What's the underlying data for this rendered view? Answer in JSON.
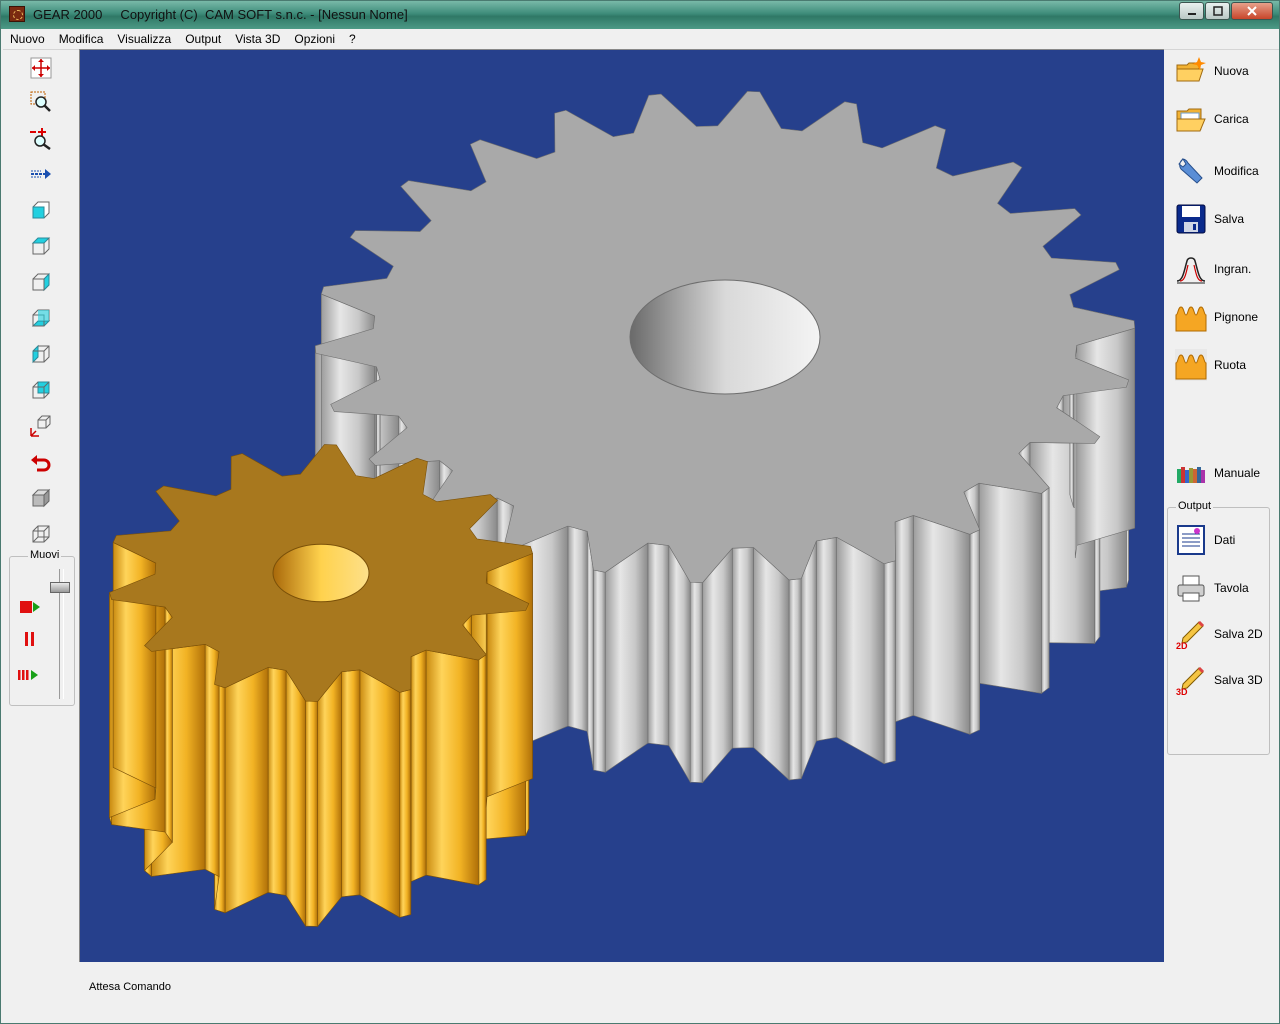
{
  "window": {
    "title": "GEAR 2000     Copyright (C)  CAM SOFT s.n.c. - [Nessun Nome]"
  },
  "menu": [
    "Nuovo",
    "Modifica",
    "Visualizza",
    "Output",
    "Vista 3D",
    "Opzioni",
    "?"
  ],
  "left_toolbar": {
    "tools": [
      {
        "icon": "pan-icon"
      },
      {
        "icon": "zoom-window-icon"
      },
      {
        "icon": "zoom-in-out-icon"
      },
      {
        "icon": "move-arrow-icon"
      },
      {
        "icon": "view-front-icon"
      },
      {
        "icon": "view-top-icon"
      },
      {
        "icon": "view-right-icon"
      },
      {
        "icon": "view-bottom-icon"
      },
      {
        "icon": "view-left-icon"
      },
      {
        "icon": "view-back-icon"
      },
      {
        "icon": "view-iso-axes-icon"
      },
      {
        "icon": "rotate-back-icon"
      },
      {
        "icon": "shaded-cube-icon"
      },
      {
        "icon": "wireframe-cube-icon"
      }
    ],
    "muovi": {
      "label": "Muovi",
      "buttons": [
        {
          "icon": "play-icon"
        },
        {
          "icon": "pause-icon"
        },
        {
          "icon": "fast-forward-icon"
        }
      ]
    }
  },
  "right_toolbar": {
    "buttons": [
      {
        "label": "Nuova",
        "icon": "new-folder-icon"
      },
      {
        "label": "Carica",
        "icon": "open-folder-icon"
      },
      {
        "label": "Modifica",
        "icon": "wrench-icon"
      },
      {
        "label": "Salva",
        "icon": "floppy-disk-icon"
      },
      {
        "label": "Ingran.",
        "icon": "tooth-profile-icon"
      },
      {
        "label": "Pignone",
        "icon": "pinion-icon"
      },
      {
        "label": "Ruota",
        "icon": "wheel-icon"
      },
      {
        "label": "Manuale",
        "icon": "books-icon"
      }
    ],
    "output": {
      "label": "Output",
      "buttons": [
        {
          "label": "Dati",
          "icon": "data-document-icon"
        },
        {
          "label": "Tavola",
          "icon": "printer-icon"
        },
        {
          "label": "Salva 2D",
          "icon": "pencil-2d-icon"
        },
        {
          "label": "Salva 3D",
          "icon": "pencil-3d-icon"
        }
      ]
    }
  },
  "viewport": {
    "background": "#26408c",
    "gear_large_color": "#b8b8b8",
    "gear_small_color": "#f0b52a",
    "gear_large_teeth": 26,
    "gear_small_teeth": 14
  },
  "status": "Attesa Comando"
}
